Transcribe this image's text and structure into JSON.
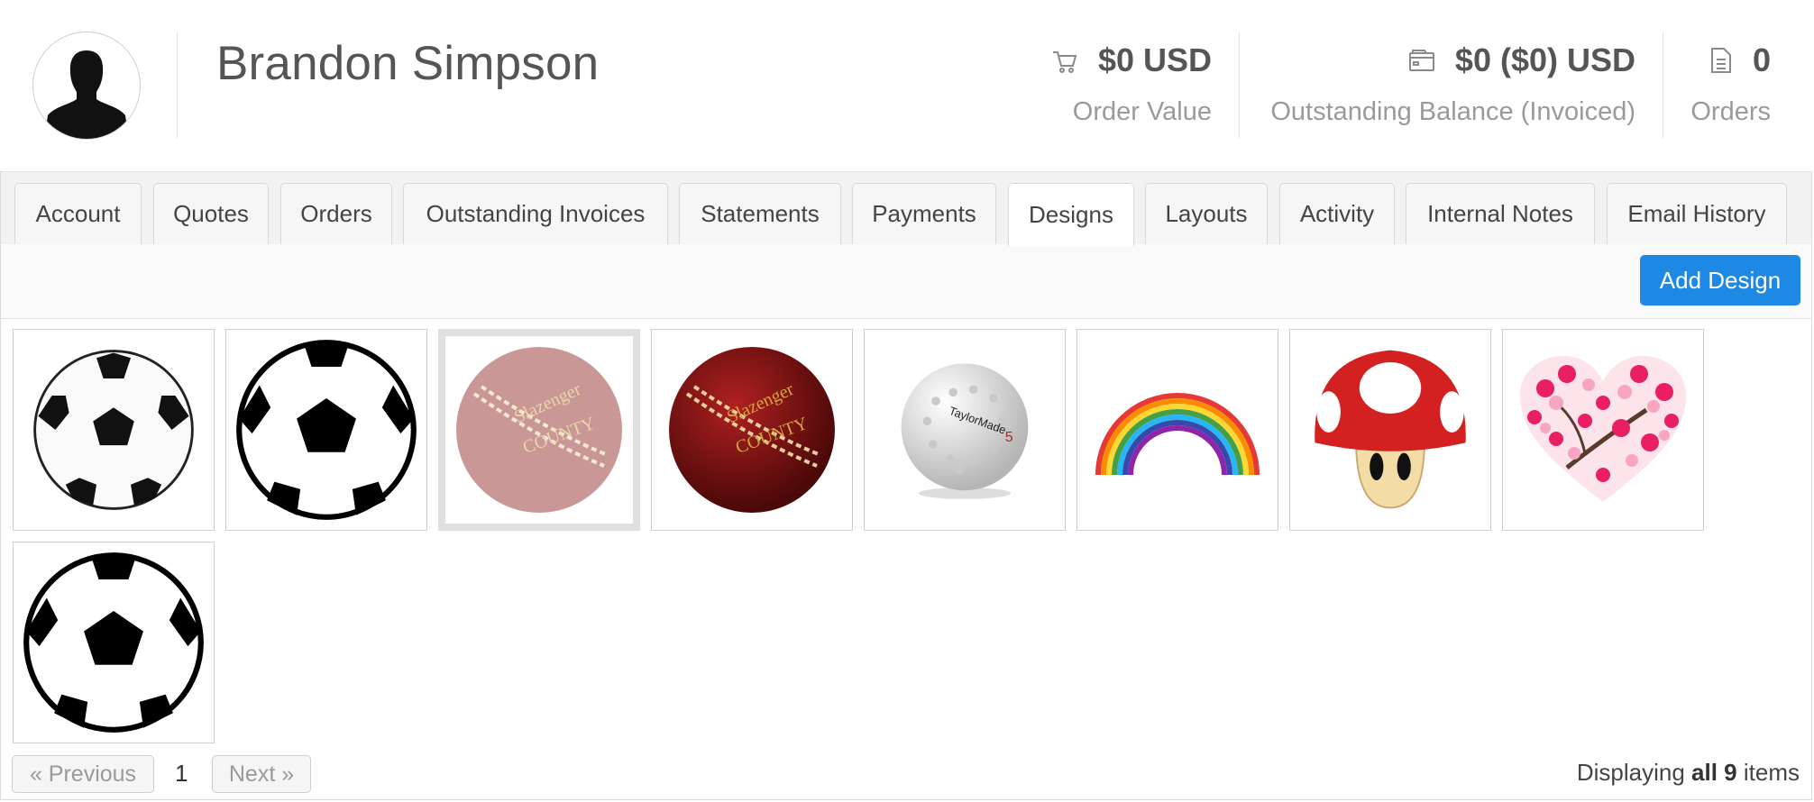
{
  "customer": {
    "name": "Brandon Simpson"
  },
  "stats": [
    {
      "id": "order-value",
      "icon": "cart-icon",
      "value": "$0 USD",
      "label": "Order Value"
    },
    {
      "id": "outstanding-balance",
      "icon": "wallet-icon",
      "value": "$0 ($0) USD",
      "label": "Outstanding Balance (Invoiced)"
    },
    {
      "id": "orders-count",
      "icon": "document-icon",
      "value": "0",
      "label": "Orders"
    }
  ],
  "tabs": [
    {
      "label": "Account"
    },
    {
      "label": "Quotes"
    },
    {
      "label": "Orders"
    },
    {
      "label": "Outstanding Invoices"
    },
    {
      "label": "Statements"
    },
    {
      "label": "Payments"
    },
    {
      "label": "Designs",
      "active": true
    },
    {
      "label": "Layouts"
    },
    {
      "label": "Activity"
    },
    {
      "label": "Internal Notes"
    },
    {
      "label": "Email History"
    }
  ],
  "toolbar": {
    "add_label": "Add Design"
  },
  "designs": [
    {
      "name": "soccer-ball-design",
      "kind": "soccer"
    },
    {
      "name": "soccer-ball-outline-design",
      "kind": "soccer-outline"
    },
    {
      "name": "cricket-ball-design",
      "kind": "cricket",
      "selected": true
    },
    {
      "name": "cricket-ball-design",
      "kind": "cricket"
    },
    {
      "name": "golf-ball-design",
      "kind": "golf"
    },
    {
      "name": "rainbow-design",
      "kind": "rainbow"
    },
    {
      "name": "mushroom-design",
      "kind": "mushroom"
    },
    {
      "name": "blossom-heart-design",
      "kind": "heart"
    },
    {
      "name": "soccer-ball-outline-design",
      "kind": "soccer-outline"
    }
  ],
  "pagination": {
    "prev_label": "« Previous",
    "next_label": "Next »",
    "current_page": "1",
    "display_prefix": "Displaying",
    "display_bold": "all 9",
    "display_suffix": "items"
  },
  "colors": {
    "accent": "#1e88e5",
    "cricket_red": "#8b1a1a",
    "mushroom_red": "#d32020"
  }
}
